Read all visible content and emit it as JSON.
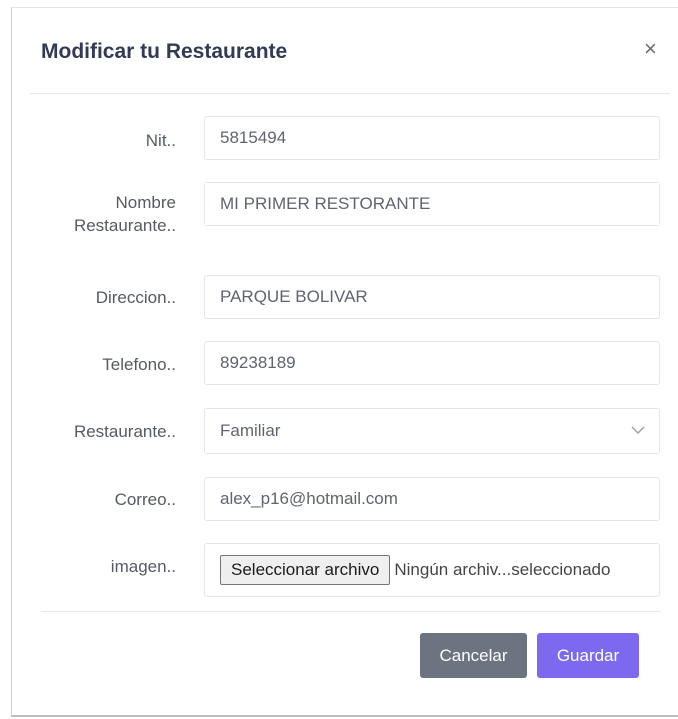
{
  "modal": {
    "title": "Modificar tu Restaurante",
    "close_icon": "close-icon"
  },
  "form": {
    "nit": {
      "label": "Nit..",
      "value": "5815494"
    },
    "nombre": {
      "label_line1": "Nombre",
      "label_line2": "Restaurante..",
      "value": "MI PRIMER RESTORANTE"
    },
    "direccion": {
      "label": "Direccion..",
      "value": "PARQUE BOLIVAR"
    },
    "telefono": {
      "label": "Telefono..",
      "value": "89238189"
    },
    "tipo": {
      "label": "Restaurante..",
      "value": "Familiar"
    },
    "correo": {
      "label": "Correo..",
      "value": "alex_p16@hotmail.com"
    },
    "imagen": {
      "label": "imagen..",
      "button": "Seleccionar archivo",
      "status": "Ningún archiv...seleccionado"
    }
  },
  "footer": {
    "cancel_label": "Cancelar",
    "save_label": "Guardar"
  },
  "colors": {
    "primary": "#7c69ef",
    "secondary": "#6b7480",
    "title": "#343a53"
  }
}
